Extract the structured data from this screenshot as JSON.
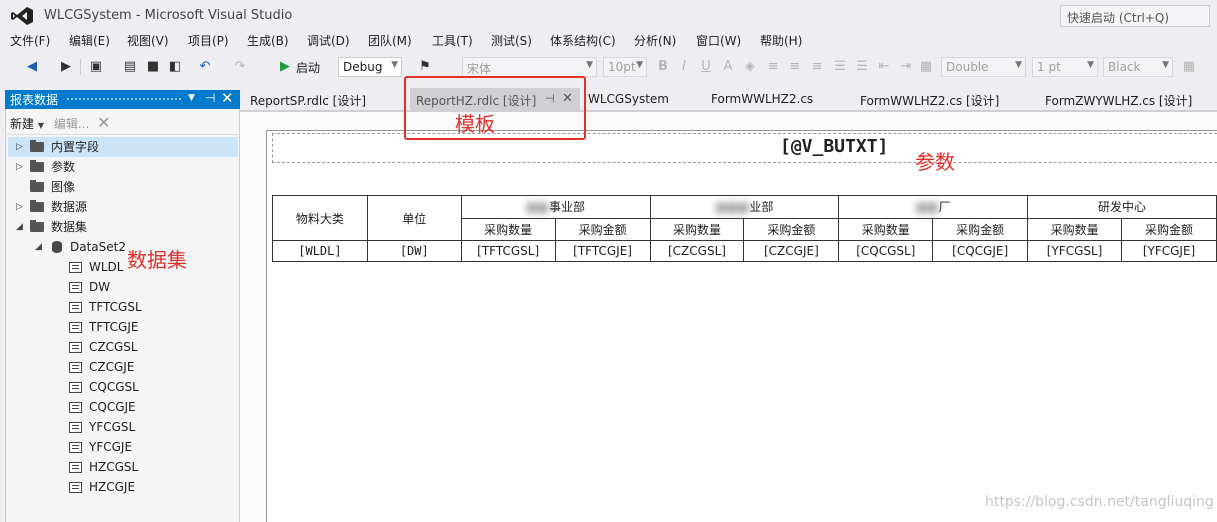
{
  "window": {
    "title": "WLCGSystem - Microsoft Visual Studio",
    "quick_launch_placeholder": "快速启动 (Ctrl+Q)"
  },
  "menu": [
    "文件(F)",
    "编辑(E)",
    "视图(V)",
    "项目(P)",
    "生成(B)",
    "调试(D)",
    "团队(M)",
    "工具(T)",
    "测试(S)",
    "体系结构(C)",
    "分析(N)",
    "窗口(W)",
    "帮助(H)"
  ],
  "toolbar": {
    "start_label": "启动",
    "config_value": "Debug",
    "font_family": "宋体",
    "font_size": "10pt",
    "border_style": "Double",
    "border_width": "1 pt",
    "border_color": "Black"
  },
  "report_data_panel": {
    "title": "报表数据",
    "new_label": "新建",
    "edit_label": "编辑...",
    "tree": {
      "builtin_fields": "内置字段",
      "parameters": "参数",
      "images": "图像",
      "data_sources": "数据源",
      "datasets": "数据集",
      "dataset_name": "DataSet2",
      "fields": [
        "WLDL",
        "DW",
        "TFTCGSL",
        "TFTCGJE",
        "CZCGSL",
        "CZCGJE",
        "CQCGSL",
        "CQCGJE",
        "YFCGSL",
        "YFCGJE",
        "HZCGSL",
        "HZCGJE"
      ]
    }
  },
  "tabs": [
    {
      "label": "ReportSP.rdlc [设计]",
      "active": false
    },
    {
      "label": "ReportHZ.rdlc [设计]",
      "active": true
    },
    {
      "label": "WLCGSystem",
      "active": false
    },
    {
      "label": "FormWWLHZ2.cs",
      "active": false
    },
    {
      "label": "FormWWLHZ2.cs [设计]",
      "active": false
    },
    {
      "label": "FormZWYWLHZ.cs [设计]",
      "active": false
    }
  ],
  "report": {
    "title_expr": "[@V_BUTXT]",
    "col_material": "物料大类",
    "col_unit": "单位",
    "groups": [
      "事业部",
      "业部",
      "厂",
      "研发中心"
    ],
    "sub_qty": "采购数量",
    "sub_amt": "采购金额",
    "row": [
      "[WLDL]",
      "[DW]",
      "[TFTCGSL]",
      "[TFTCGJE]",
      "[CZCGSL]",
      "[CZCGJE]",
      "[CQCGSL]",
      "[CQCGJE]",
      "[YFCGSL]",
      "[YFCGJE]"
    ]
  },
  "annotations": {
    "template": "模板",
    "parameter": "参数",
    "dataset": "数据集"
  },
  "watermark": "https://blog.csdn.net/tangliuqing"
}
